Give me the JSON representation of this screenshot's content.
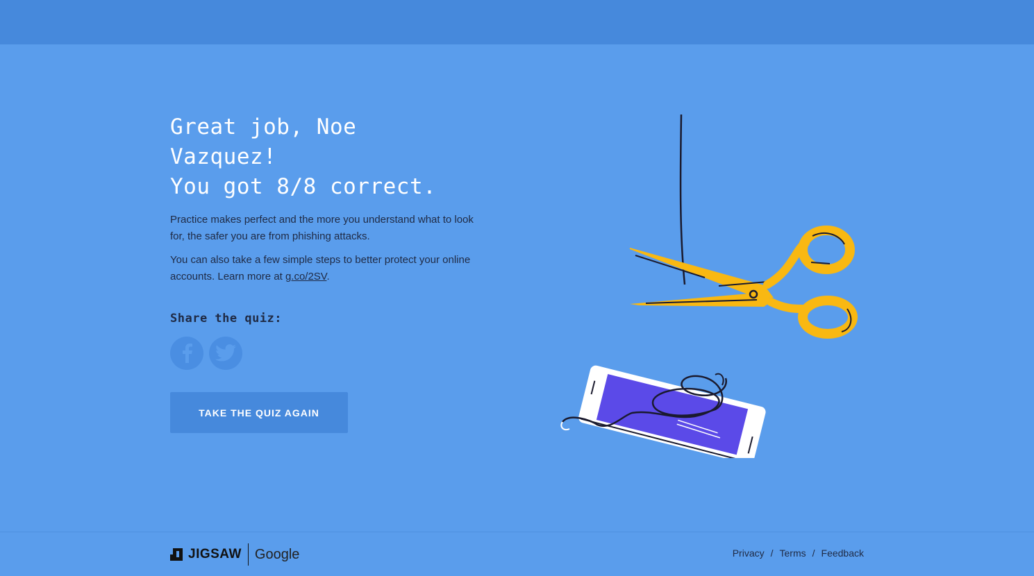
{
  "headline": {
    "line1": "Great job, Noe",
    "line2": "Vazquez!",
    "line3": "You got 8/8 correct."
  },
  "body": {
    "paragraph1": "Practice makes perfect and the more you understand what to look for, the safer you are from phishing attacks.",
    "paragraph2_prefix": "You can also take a few simple steps to better protect your online accounts. Learn more at ",
    "paragraph2_link": "g.co/2SV",
    "paragraph2_suffix": "."
  },
  "share": {
    "title": "Share the quiz:",
    "buttons": [
      {
        "icon": "facebook-icon"
      },
      {
        "icon": "twitter-icon"
      }
    ]
  },
  "actions": {
    "retake_label": "TAKE THE QUIZ AGAIN"
  },
  "footer": {
    "brand_jigsaw": "JIGSAW",
    "brand_google": "Google",
    "links": [
      "Privacy",
      "Terms",
      "Feedback"
    ],
    "separator": "/"
  },
  "colors": {
    "background": "#5a9dec",
    "topbar": "#4689dc",
    "button": "#4689dc",
    "scissors": "#f9b812",
    "phone_screen": "#5b4ae8"
  }
}
